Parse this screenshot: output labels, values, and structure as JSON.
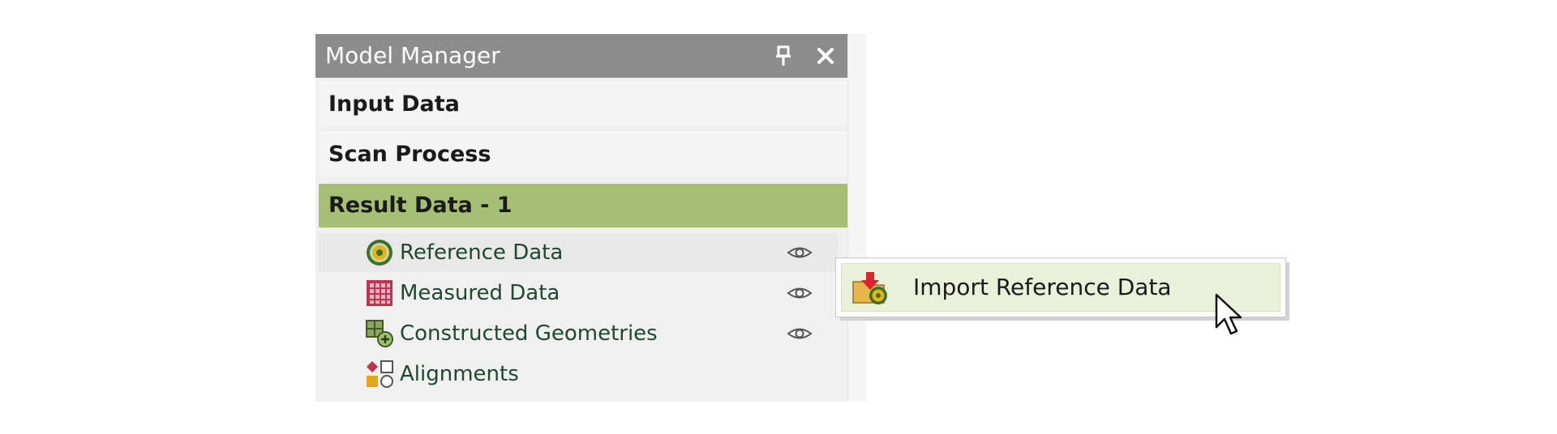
{
  "panel": {
    "title": "Model Manager",
    "sections": {
      "input": "Input Data",
      "scan": "Scan Process",
      "result": "Result Data - 1"
    },
    "items": [
      {
        "label": "Reference Data",
        "icon": "reference-data-icon",
        "visibility_icon": "eye-icon"
      },
      {
        "label": "Measured Data",
        "icon": "measured-data-icon",
        "visibility_icon": "eye-icon"
      },
      {
        "label": "Constructed Geometries",
        "icon": "constructed-geometries-icon",
        "visibility_icon": "eye-icon"
      },
      {
        "label": "Alignments",
        "icon": "alignments-icon"
      }
    ],
    "buttons": {
      "pin": "pin-icon",
      "close": "close-icon"
    }
  },
  "context_menu": {
    "items": [
      {
        "label": "Import Reference Data",
        "icon": "import-reference-data-icon"
      }
    ]
  },
  "colors": {
    "titlebar": "#8c8c8c",
    "result_section": "#a6bf74",
    "item_text": "#1f4733",
    "menu_highlight": "#eaf1da"
  }
}
